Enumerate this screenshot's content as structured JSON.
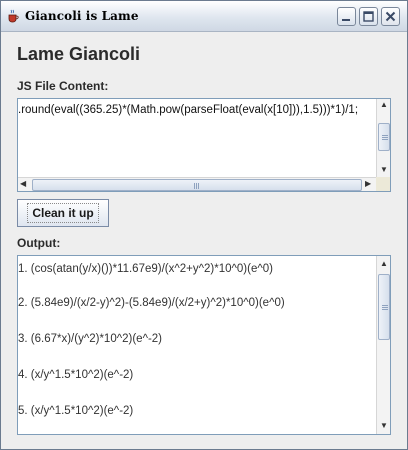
{
  "window": {
    "title": "Giancoli is Lame",
    "icon": "java-cup-icon",
    "controls": [
      "minimize-icon",
      "maximize-icon",
      "close-icon"
    ]
  },
  "main": {
    "heading": "Lame Giancoli",
    "js_label": "JS File Content:",
    "js_content": ".round(eval((365.25)*(Math.pow(parseFloat(eval(x[10])),1.5)))*1)/1;",
    "button_label": "Clean it up",
    "output_label": "Output:",
    "output_lines": [
      "1.  (cos(atan(y/x)())*11.67e9)/(x^2+y^2)*10^0)(e^0)",
      "2.  (5.84e9)/(x/2-y)^2)-(5.84e9)/(x/2+y)^2)*10^0)(e^0)",
      "3.  (6.67*x)/(y^2)*10^2)(e^-2)",
      "4.  (x/y^1.5*10^2)(e^-2)",
      "5.  (x/y^1.5*10^2)(e^-2)"
    ]
  },
  "colors": {
    "field_border": "#7f9db9",
    "window_bg": "#eeeeee",
    "scroll_thumb": "#d6dfec"
  }
}
